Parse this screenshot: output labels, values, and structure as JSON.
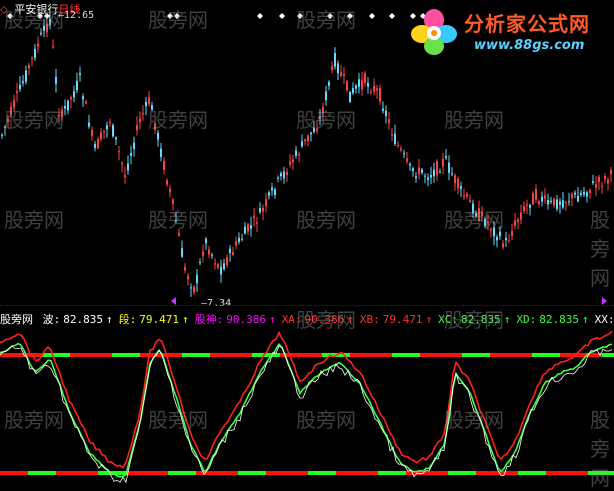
{
  "title": {
    "icon": "stock-icon",
    "name": "平安银行",
    "period": "日线",
    "colors": {
      "name": "#ffffff",
      "period": "#ff3030"
    }
  },
  "price_panel": {
    "high_label": "12.65",
    "low_label": "7.34",
    "marker_icon": "diamond-icon"
  },
  "logo": {
    "text": "分析家公式网",
    "url": "www.88gs.com"
  },
  "watermark": "股旁网",
  "oscillator": {
    "name": "股旁网",
    "items": [
      {
        "label": "波:",
        "value": "82.835",
        "arrow": "↑",
        "color": "#ffffff"
      },
      {
        "label": "段:",
        "value": "79.471",
        "arrow": "↑",
        "color": "#ffff00"
      },
      {
        "label": "股神:",
        "value": "90.386",
        "arrow": "↑",
        "color": "#ff00ff"
      },
      {
        "label": "XA:",
        "value": "90.386",
        "arrow": "↑",
        "color": "#ff3030"
      },
      {
        "label": "XB:",
        "value": "79.471",
        "arrow": "↑",
        "color": "#ff3030"
      },
      {
        "label": "XC:",
        "value": "82.835",
        "arrow": "↑",
        "color": "#40ff40"
      },
      {
        "label": "XD:",
        "value": "82.835",
        "arrow": "↑",
        "color": "#40ff40"
      },
      {
        "label": "XX:",
        "value": "",
        "arrow": "",
        "color": "#ffffff"
      }
    ]
  },
  "colors": {
    "background": "#000000",
    "up_candle": "#ff4040",
    "down_candle": "#66d9ff",
    "white_line": "#ffffff",
    "green_line": "#40ff40",
    "red_line": "#ff2020",
    "band_green": "#20ff20",
    "band_red": "#ff1010",
    "marker": "#cc33ff"
  }
}
